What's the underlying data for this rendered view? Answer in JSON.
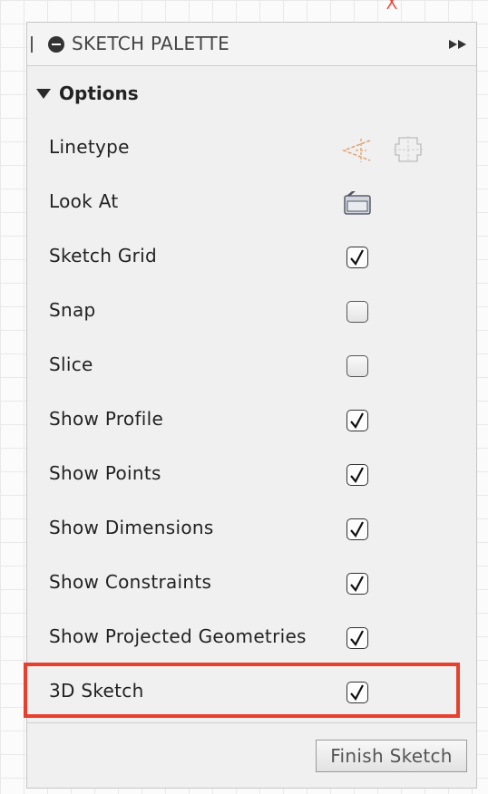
{
  "palette": {
    "title": "SKETCH PALETTE",
    "section_label": "Options",
    "rows": [
      {
        "label": "Linetype",
        "control": "icons"
      },
      {
        "label": "Look At",
        "control": "look-at-icon"
      },
      {
        "label": "Sketch Grid",
        "checked": true
      },
      {
        "label": "Snap",
        "checked": false
      },
      {
        "label": "Slice",
        "checked": false
      },
      {
        "label": "Show Profile",
        "checked": true
      },
      {
        "label": "Show Points",
        "checked": true
      },
      {
        "label": "Show Dimensions",
        "checked": true
      },
      {
        "label": "Show Constraints",
        "checked": true
      },
      {
        "label": "Show Projected Geometries",
        "checked": true
      },
      {
        "label": "3D Sketch",
        "checked": true,
        "highlighted": true
      }
    ],
    "finish_button_label": "Finish Sketch"
  },
  "colors": {
    "highlight": "#e8402e",
    "panel_bg": "#f0f0f0",
    "axis_marker": "#e8402e"
  },
  "icons": {
    "minimize": "minus-circle-icon",
    "expand": "double-arrow-right-icon",
    "collapse": "triangle-down-icon",
    "linetype": "construction-line-icon",
    "centerline": "centerline-icon",
    "look_at": "look-at-icon"
  }
}
